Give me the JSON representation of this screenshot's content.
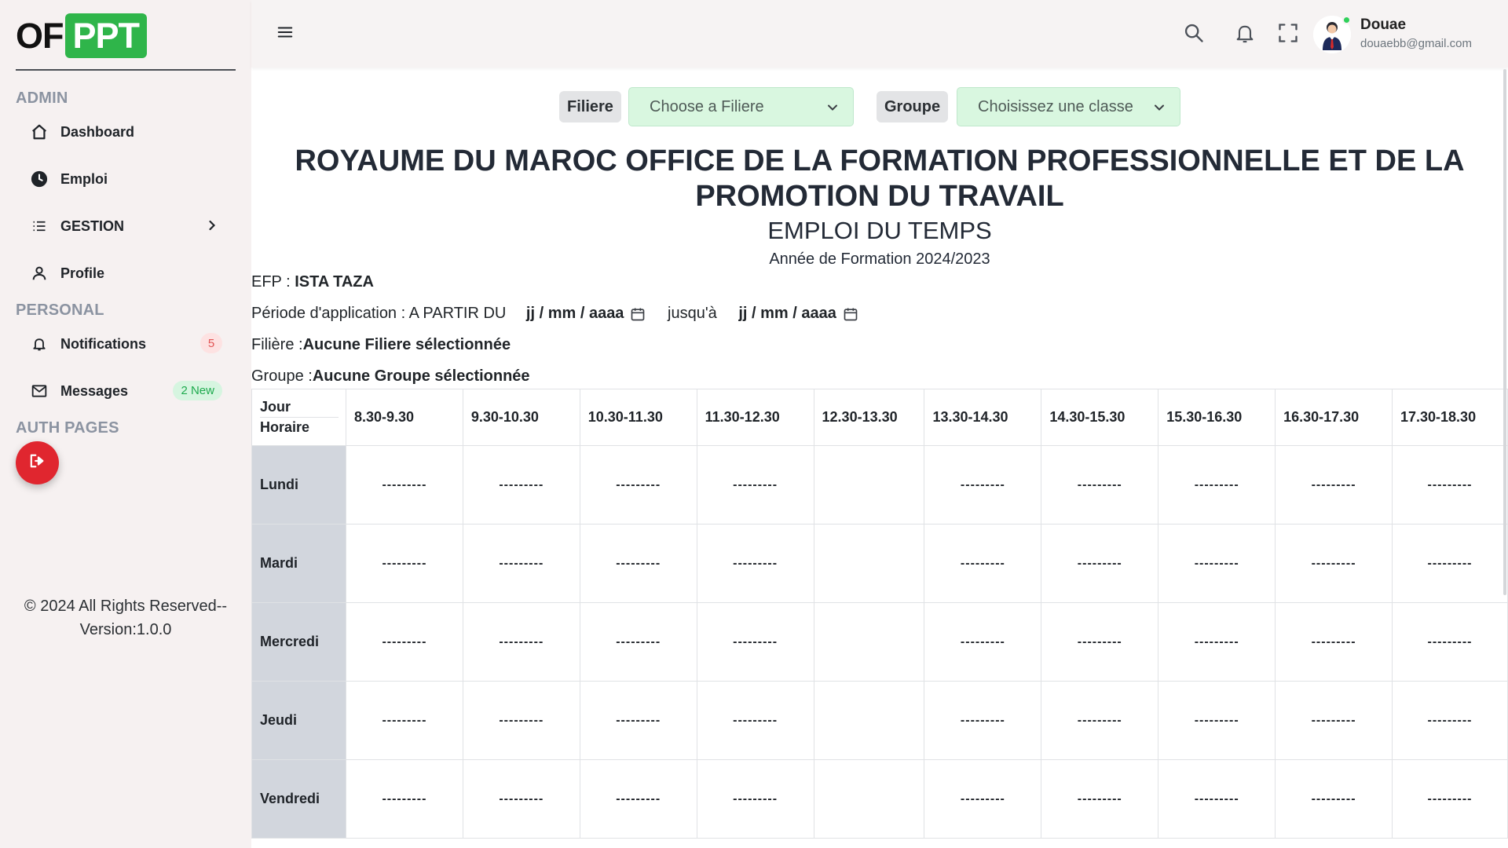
{
  "logo": {
    "part1": "OF",
    "part2": "PPT"
  },
  "sidebar": {
    "sections": {
      "admin": "ADMIN",
      "personal": "PERSONAL",
      "auth": "AUTH PAGES"
    },
    "items": [
      {
        "label": "Dashboard",
        "icon": "home-icon"
      },
      {
        "label": "Emploi",
        "icon": "clock-icon"
      },
      {
        "label": "GESTION",
        "icon": "list-icon"
      },
      {
        "label": "Profile",
        "icon": "user-icon"
      },
      {
        "label": "Notifications",
        "icon": "bell-icon",
        "badge": "5"
      },
      {
        "label": "Messages",
        "icon": "mail-icon",
        "badge": "2 New"
      }
    ],
    "footer_line1": "© 2024 All Rights Reserved--",
    "footer_line2": "Version:1.0.0"
  },
  "topbar": {
    "user_name": "Douae",
    "user_email": "douaebb@gmail.com"
  },
  "filters": {
    "filiere_label": "Filiere",
    "filiere_value": "Choose a Filiere",
    "groupe_label": "Groupe",
    "groupe_value": "Choisissez une classe"
  },
  "header": {
    "title_line1": "ROYAUME DU MAROC OFFICE DE LA FORMATION PROFESSIONNELLE ET DE LA",
    "title_line2": "PROMOTION DU TRAVAIL",
    "subtitle": "EMPLOI DU TEMPS",
    "year": "Année de Formation 2024/2023"
  },
  "info": {
    "efp_label": "EFP : ",
    "efp_value": "ISTA TAZA",
    "periode_label": "Période d'application : A PARTIR DU",
    "date_placeholder": "jj / mm / aaaa",
    "jusqua": "jusqu'à",
    "filiere_label": "Filière :",
    "filiere_value": "Aucune Filiere sélectionnée",
    "groupe_label": "Groupe :",
    "groupe_value": "Aucune Groupe sélectionnée"
  },
  "schedule": {
    "corner_jour": "Jour",
    "corner_horaire": "Horaire",
    "slots": [
      "8.30-9.30",
      "9.30-10.30",
      "10.30-11.30",
      "11.30-12.30",
      "12.30-13.30",
      "13.30-14.30",
      "14.30-15.30",
      "15.30-16.30",
      "16.30-17.30",
      "17.30-18.30"
    ],
    "days": [
      "Lundi",
      "Mardi",
      "Mercredi",
      "Jeudi",
      "Vendredi"
    ],
    "empty_cell": "---------",
    "break_slot_index": 4
  },
  "colors": {
    "brand_green": "#2fb54a",
    "logout_red": "#e0262f",
    "select_bg": "#d9f7e0",
    "day_column_bg": "#d2d6dd"
  }
}
